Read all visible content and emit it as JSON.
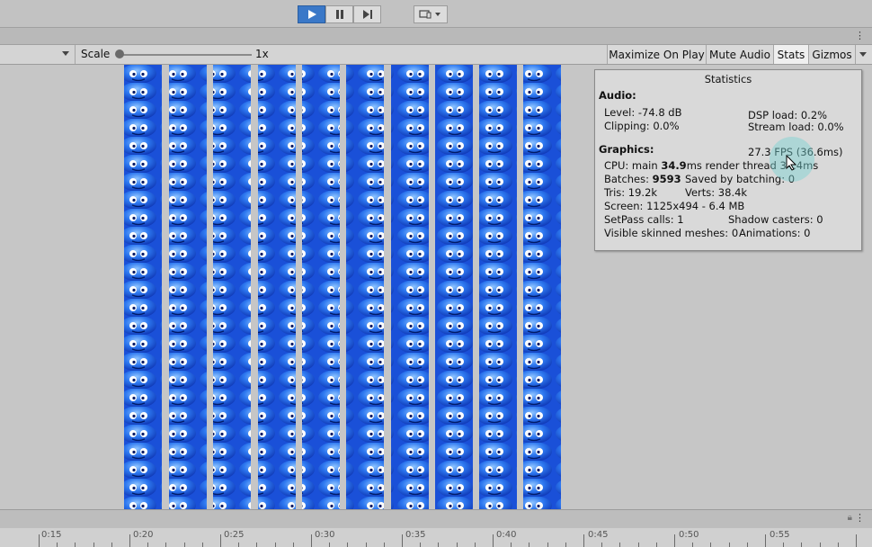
{
  "toolbar": {
    "scale_label": "Scale",
    "scale_value": "1x",
    "maximize_label": "Maximize On Play",
    "mute_label": "Mute Audio",
    "stats_label": "Stats",
    "gizmos_label": "Gizmos"
  },
  "stats": {
    "title": "Statistics",
    "audio_header": "Audio:",
    "level": "Level: -74.8 dB",
    "dsp": "DSP load: 0.2%",
    "clipping": "Clipping: 0.0%",
    "stream": "Stream load: 0.0%",
    "graphics_header": "Graphics:",
    "fps": "27.3 FPS (36.6ms)",
    "cpu_prefix": "CPU: main",
    "cpu_main": "34.9",
    "cpu_suffix": "ms  render thread 34.4ms",
    "batches_prefix": "Batches:",
    "batches": "9593",
    "saved": "Saved by batching: 0",
    "tris": "Tris: 19.2k",
    "verts": "Verts: 38.4k",
    "screen": "Screen: 1125x494 - 6.4 MB",
    "setpass": "SetPass calls: 1",
    "shadow": "Shadow casters: 0",
    "skinned": "Visible skinned meshes: 0",
    "animations": "Animations: 0"
  },
  "timeline": {
    "labels": [
      "0:15",
      "0:20",
      "0:25",
      "0:30",
      "0:35",
      "0:40",
      "0:45",
      "0:50",
      "0:55"
    ]
  },
  "icons": {
    "play": "play-icon",
    "pause": "pause-icon",
    "step": "step-icon",
    "device": "device-icon"
  },
  "colors": {
    "play_active": "#3a78c8",
    "sprite_blue": "#1f5fe0"
  }
}
